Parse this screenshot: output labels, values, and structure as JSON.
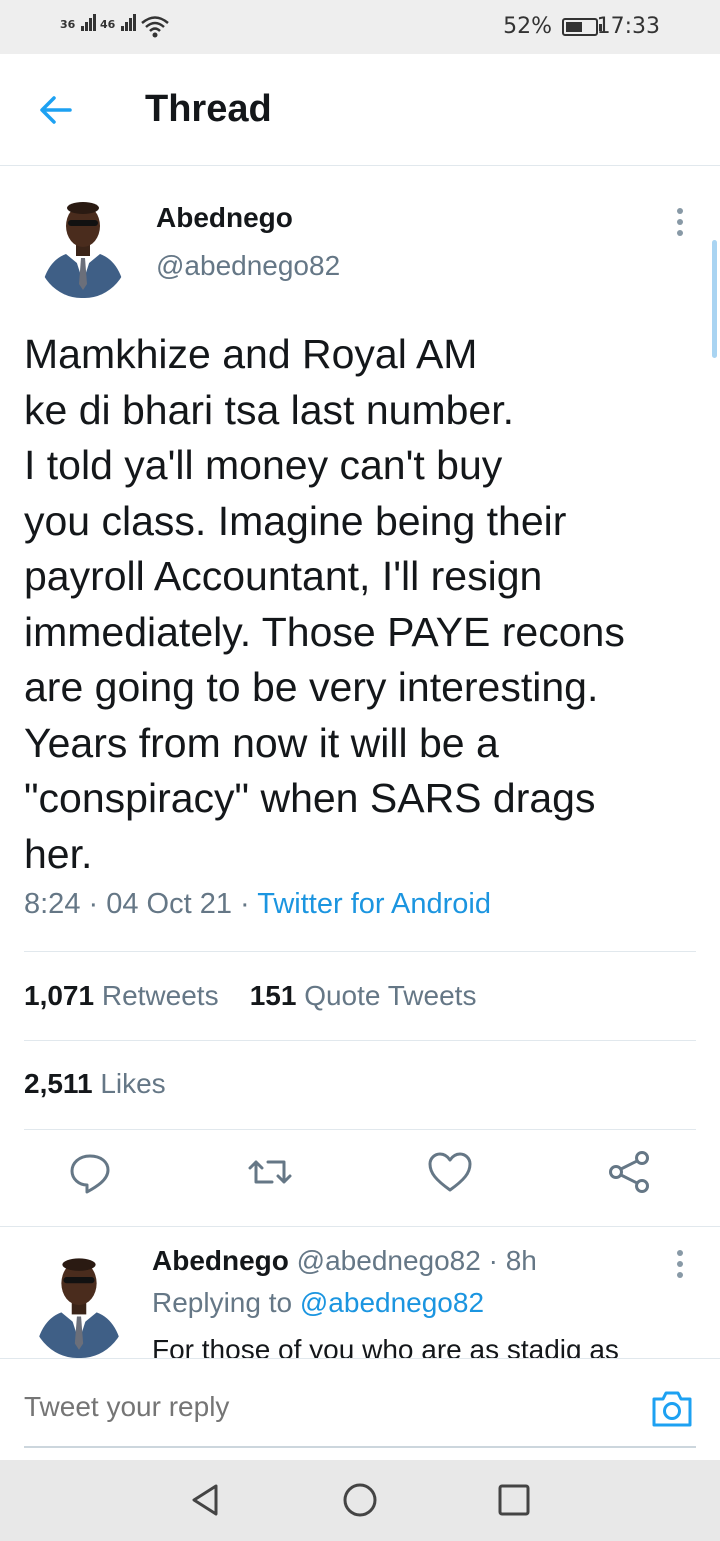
{
  "status_bar": {
    "signal1_label": "36",
    "signal2_label": "46",
    "battery": "52%",
    "time": "17:33"
  },
  "header": {
    "title": "Thread",
    "back_icon": "arrow-left-icon"
  },
  "tweet": {
    "author_name": "Abednego",
    "author_handle": "@abednego82",
    "text": "Mamkhize and Royal AM\nke di bhari tsa last number.\nI told ya'll money can't buy\nyou class. Imagine being their\npayroll Accountant, I'll resign\nimmediately. Those PAYE recons\nare going to be very interesting.\nYears from now it will be a\n\"conspiracy\" when SARS drags\nher.",
    "time": "8:24",
    "sep1": " · ",
    "date": "04 Oct 21",
    "sep2": " · ",
    "source": "Twitter for Android",
    "retweets_count": "1,071",
    "retweets_label": "Retweets",
    "quotes_count": "151",
    "quotes_label": "Quote Tweets",
    "likes_count": "2,511",
    "likes_label": "Likes"
  },
  "actions": {
    "reply": "reply-icon",
    "retweet": "retweet-icon",
    "like": "heart-icon",
    "share": "share-icon"
  },
  "reply_tweet": {
    "author_name": "Abednego",
    "author_handle": "@abednego82",
    "age": "· 8h",
    "replying_to_label": "Replying to",
    "replying_to_handle": "@abednego82",
    "text": "For those of you who are as stadig as"
  },
  "composer": {
    "placeholder": "Tweet your reply"
  },
  "colors": {
    "accent": "#1da1f2",
    "link": "#1b95e0",
    "secondary_text": "#657786",
    "primary_text": "#14171a"
  }
}
